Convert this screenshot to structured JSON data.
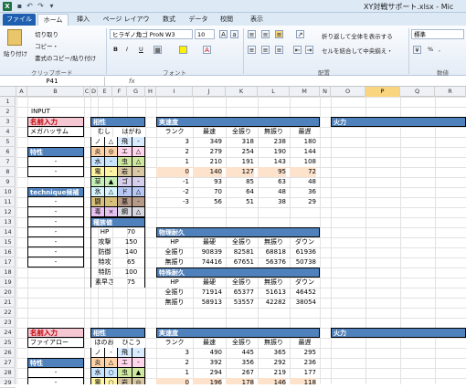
{
  "window": {
    "title": "XY対戦サポート.xlsx - Mic",
    "quick_access": [
      "save-icon",
      "undo-icon",
      "redo-icon",
      "dropdown-icon"
    ]
  },
  "tabs": [
    "ファイル",
    "ホーム",
    "挿入",
    "ページ レイアウト",
    "数式",
    "データ",
    "校閲",
    "表示"
  ],
  "ribbon": {
    "clipboard": {
      "paste": "貼り付け",
      "cut": "切り取り",
      "copy": "コピー・",
      "format_painter": "書式のコピー/貼り付け",
      "label": "クリップボード"
    },
    "font": {
      "name": "ヒラギノ角ゴ ProN W3",
      "size": "10",
      "bold": "B",
      "italic": "I",
      "underline": "U",
      "label": "フォント"
    },
    "alignment": {
      "wrap": "折り返して全体を表示する",
      "merge": "セルを結合して中央揃え・",
      "label": "配置"
    },
    "number": {
      "format": "標準",
      "percent": "%",
      "comma": ",",
      "label": "数値"
    }
  },
  "formula_bar": {
    "name_box": "P41",
    "fx": "fx",
    "value": ""
  },
  "columns": [
    "A",
    "B",
    "C",
    "D",
    "E",
    "F",
    "G",
    "H",
    "I",
    "J",
    "K",
    "L",
    "M",
    "N",
    "O",
    "P",
    "Q",
    "R"
  ],
  "selected_column": "P",
  "rows": [
    "1",
    "2",
    "3",
    "4",
    "5",
    "6",
    "7",
    "8",
    "9",
    "10",
    "11",
    "12",
    "13",
    "14",
    "15",
    "16",
    "17",
    "18",
    "19",
    "20",
    "21",
    "22",
    "23",
    "24",
    "25",
    "26",
    "27",
    "28",
    "29"
  ],
  "sheet": {
    "input_label": "INPUT",
    "block1": {
      "name_label": "名前入力",
      "name": "メガハッサム",
      "trait_label": "特性",
      "traits": [
        "-",
        "-"
      ],
      "moves_label": "technique候補技",
      "moves": [
        "-",
        "-",
        "-",
        "-",
        "-",
        "-",
        "-"
      ],
      "type_label": "相性",
      "type1": "むし",
      "type2": "はがね",
      "type_rows": [
        [
          "ノ",
          "△",
          "飛",
          "-"
        ],
        [
          "炎",
          "◎",
          "エ",
          "△"
        ],
        [
          "水",
          "-",
          "虫",
          "△"
        ],
        [
          "電",
          "-",
          "岩",
          "-"
        ],
        [
          "草",
          "▲",
          "ゴ",
          "-"
        ],
        [
          "氷",
          "△",
          "ド",
          "△"
        ],
        [
          "闘",
          "-",
          "悪",
          "-"
        ],
        [
          "毒",
          "×",
          "鋼",
          "△"
        ],
        [
          "地",
          "-",
          "フ",
          "△"
        ]
      ],
      "stats_label": "種族値",
      "stats": [
        [
          "HP",
          "70"
        ],
        [
          "攻撃",
          "150"
        ],
        [
          "防御",
          "140"
        ],
        [
          "特攻",
          "65"
        ],
        [
          "特防",
          "100"
        ],
        [
          "素早さ",
          "75"
        ]
      ],
      "speed": {
        "label": "実速度",
        "headers": [
          "ランク",
          "最速",
          "全振り",
          "無振り",
          "最遅"
        ],
        "rows": [
          [
            "3",
            "349",
            "318",
            "238",
            "180"
          ],
          [
            "2",
            "279",
            "254",
            "190",
            "144"
          ],
          [
            "1",
            "210",
            "191",
            "143",
            "108"
          ],
          [
            "0",
            "140",
            "127",
            "95",
            "72"
          ],
          [
            "-1",
            "93",
            "85",
            "63",
            "48"
          ],
          [
            "-2",
            "70",
            "64",
            "48",
            "36"
          ],
          [
            "-3",
            "56",
            "51",
            "38",
            "29"
          ]
        ]
      },
      "phys": {
        "label": "物理耐久",
        "headers": [
          "HP",
          "最硬",
          "全振り",
          "無振り",
          "ダウン"
        ],
        "rows": [
          [
            "全振り",
            "90839",
            "82581",
            "68818",
            "61936"
          ],
          [
            "無振り",
            "74416",
            "67651",
            "56376",
            "50738"
          ]
        ]
      },
      "spec": {
        "label": "特殊耐久",
        "headers": [
          "HP",
          "最硬",
          "全振り",
          "無振り",
          "ダウン"
        ],
        "rows": [
          [
            "全振り",
            "71914",
            "65377",
            "51613",
            "46452"
          ],
          [
            "無振り",
            "58913",
            "53557",
            "42282",
            "38054"
          ]
        ]
      },
      "fire_label": "火力"
    },
    "block2": {
      "name_label": "名前入力",
      "name": "ファイアロー",
      "trait_label": "特性",
      "traits": [
        "-",
        "-"
      ],
      "type_label": "相性",
      "type1": "ほのお",
      "type2": "ひこう",
      "type_rows": [
        [
          "ノ",
          "-",
          "飛",
          "-"
        ],
        [
          "炎",
          "△",
          "エ",
          "-"
        ],
        [
          "水",
          "○",
          "虫",
          "▲"
        ],
        [
          "電",
          "○",
          "岩",
          "◎"
        ]
      ],
      "speed": {
        "label": "実速度",
        "headers": [
          "ランク",
          "最速",
          "全振り",
          "無振り",
          "最遅"
        ],
        "rows": [
          [
            "3",
            "490",
            "445",
            "365",
            "295"
          ],
          [
            "2",
            "392",
            "356",
            "292",
            "236"
          ],
          [
            "1",
            "294",
            "267",
            "219",
            "177"
          ],
          [
            "0",
            "196",
            "178",
            "146",
            "118"
          ]
        ]
      },
      "fire_label": "火力"
    }
  },
  "colors": {
    "header_blue": "#4f81bd",
    "name_pink": "#f4c7d3",
    "selected_col": "#f8d57e",
    "excel_green": "#207245"
  }
}
